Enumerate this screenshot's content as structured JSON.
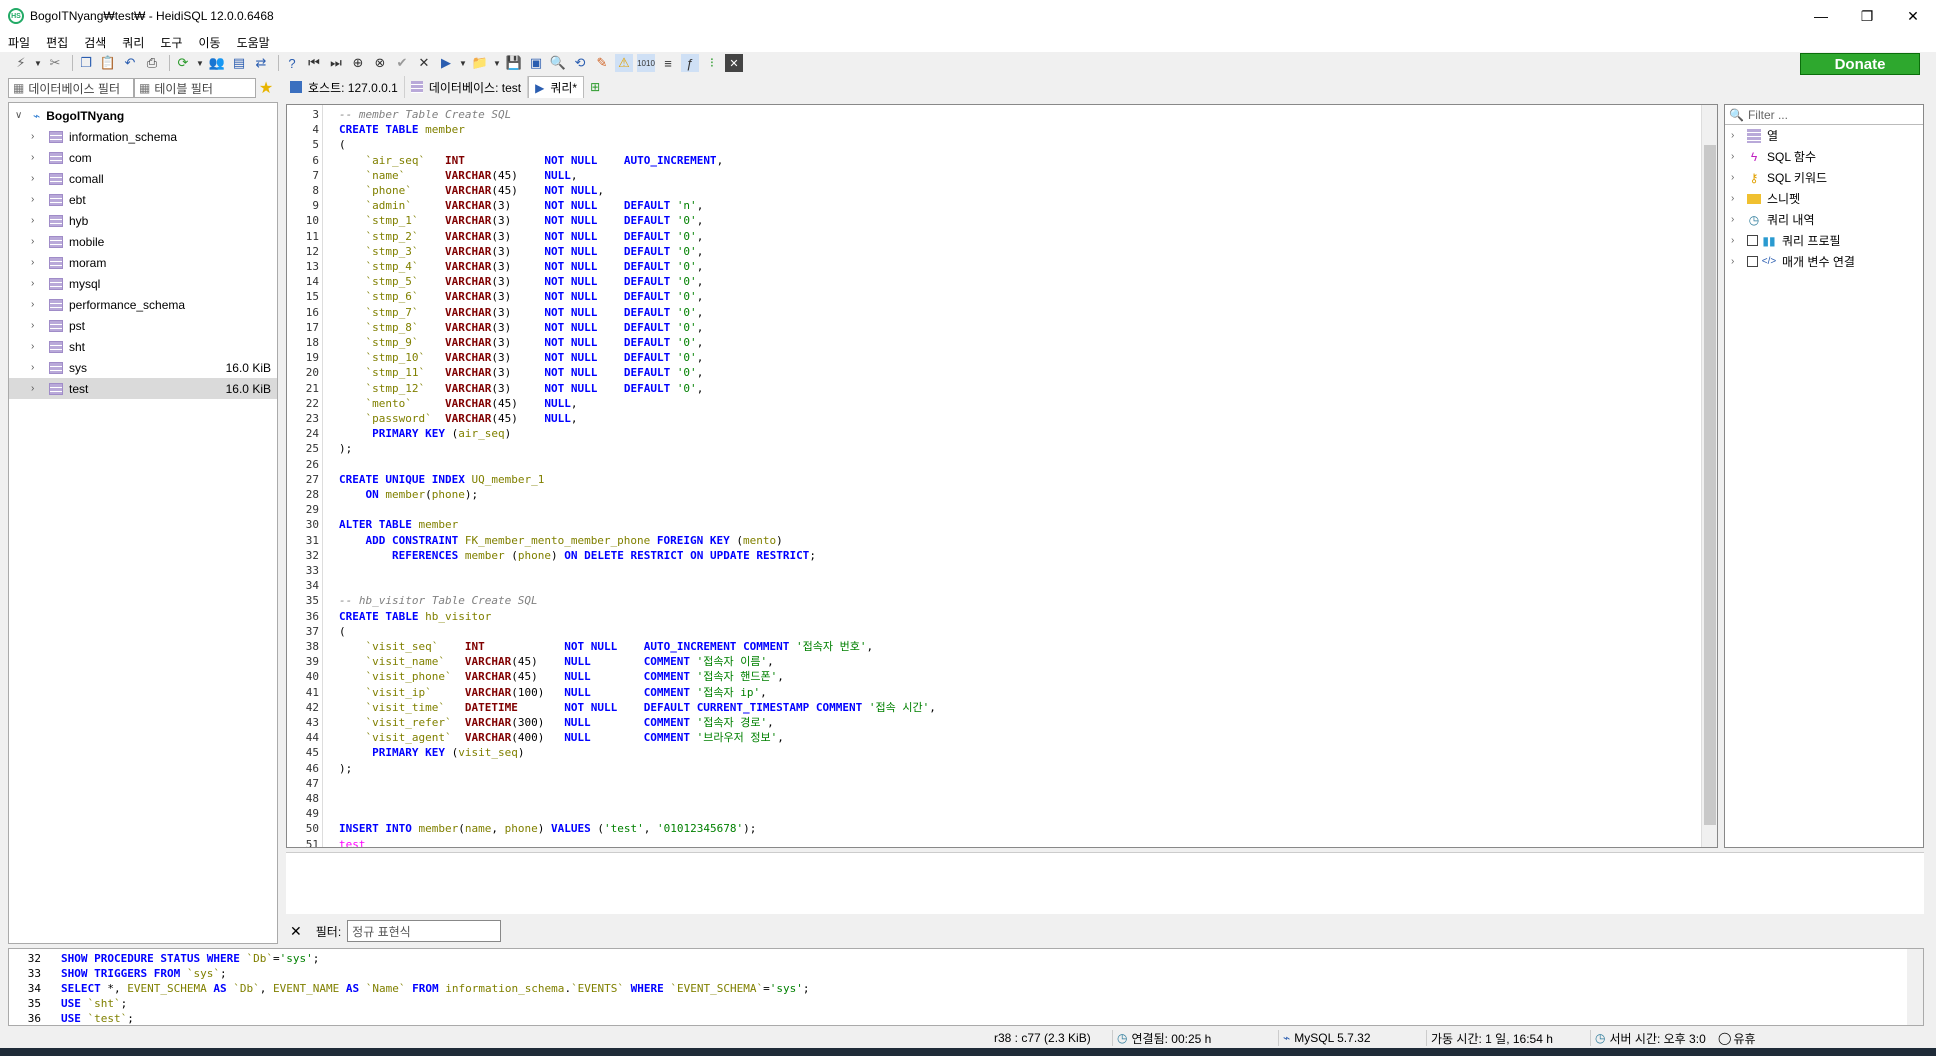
{
  "window": {
    "title": "BogoITNyang₩test₩ - HeidiSQL 12.0.0.6468",
    "minimize": "—",
    "restore": "❐",
    "close": "✕"
  },
  "menu": [
    "파일",
    "편집",
    "검색",
    "쿼리",
    "도구",
    "이동",
    "도움말"
  ],
  "donate_label": "Donate",
  "filters": {
    "database_filter_placeholder": "데이터베이스 필터",
    "table_filter_placeholder": "테이블 필터"
  },
  "tabs": [
    {
      "label": "호스트: 127.0.0.1"
    },
    {
      "label": "데이터베이스: test"
    },
    {
      "label": "쿼리*"
    }
  ],
  "tree": {
    "root": "BogoITNyang",
    "databases": [
      {
        "name": "information_schema",
        "size": ""
      },
      {
        "name": "com",
        "size": ""
      },
      {
        "name": "comall",
        "size": ""
      },
      {
        "name": "ebt",
        "size": ""
      },
      {
        "name": "hyb",
        "size": ""
      },
      {
        "name": "mobile",
        "size": ""
      },
      {
        "name": "moram",
        "size": ""
      },
      {
        "name": "mysql",
        "size": ""
      },
      {
        "name": "performance_schema",
        "size": ""
      },
      {
        "name": "pst",
        "size": ""
      },
      {
        "name": "sht",
        "size": ""
      },
      {
        "name": "sys",
        "size": "16.0 KiB"
      },
      {
        "name": "test",
        "size": "16.0 KiB"
      }
    ]
  },
  "editor_lines": [
    {
      "n": "3",
      "t": "-- member Table Create SQL"
    },
    {
      "n": "4",
      "t": "CREATE TABLE member"
    },
    {
      "n": "5",
      "t": "("
    },
    {
      "n": "6",
      "t": "    `air_seq`   INT            NOT NULL    AUTO_INCREMENT,"
    },
    {
      "n": "7",
      "t": "    `name`      VARCHAR(45)    NULL,"
    },
    {
      "n": "8",
      "t": "    `phone`     VARCHAR(45)    NOT NULL,"
    },
    {
      "n": "9",
      "t": "    `admin`     VARCHAR(3)     NOT NULL    DEFAULT 'n',"
    },
    {
      "n": "10",
      "t": "    `stmp_1`    VARCHAR(3)     NOT NULL    DEFAULT '0',"
    },
    {
      "n": "11",
      "t": "    `stmp_2`    VARCHAR(3)     NOT NULL    DEFAULT '0',"
    },
    {
      "n": "12",
      "t": "    `stmp_3`    VARCHAR(3)     NOT NULL    DEFAULT '0',"
    },
    {
      "n": "13",
      "t": "    `stmp_4`    VARCHAR(3)     NOT NULL    DEFAULT '0',"
    },
    {
      "n": "14",
      "t": "    `stmp_5`    VARCHAR(3)     NOT NULL    DEFAULT '0',"
    },
    {
      "n": "15",
      "t": "    `stmp_6`    VARCHAR(3)     NOT NULL    DEFAULT '0',"
    },
    {
      "n": "16",
      "t": "    `stmp_7`    VARCHAR(3)     NOT NULL    DEFAULT '0',"
    },
    {
      "n": "17",
      "t": "    `stmp_8`    VARCHAR(3)     NOT NULL    DEFAULT '0',"
    },
    {
      "n": "18",
      "t": "    `stmp_9`    VARCHAR(3)     NOT NULL    DEFAULT '0',"
    },
    {
      "n": "19",
      "t": "    `stmp_10`   VARCHAR(3)     NOT NULL    DEFAULT '0',"
    },
    {
      "n": "20",
      "t": "    `stmp_11`   VARCHAR(3)     NOT NULL    DEFAULT '0',"
    },
    {
      "n": "21",
      "t": "    `stmp_12`   VARCHAR(3)     NOT NULL    DEFAULT '0',"
    },
    {
      "n": "22",
      "t": "    `mento`     VARCHAR(45)    NULL,"
    },
    {
      "n": "23",
      "t": "    `password`  VARCHAR(45)    NULL,"
    },
    {
      "n": "24",
      "t": "     PRIMARY KEY (air_seq)"
    },
    {
      "n": "25",
      "t": ");"
    },
    {
      "n": "26",
      "t": ""
    },
    {
      "n": "27",
      "t": "CREATE UNIQUE INDEX UQ_member_1"
    },
    {
      "n": "28",
      "t": "    ON member(phone);"
    },
    {
      "n": "29",
      "t": ""
    },
    {
      "n": "30",
      "t": "ALTER TABLE member"
    },
    {
      "n": "31",
      "t": "    ADD CONSTRAINT FK_member_mento_member_phone FOREIGN KEY (mento)"
    },
    {
      "n": "32",
      "t": "        REFERENCES member (phone) ON DELETE RESTRICT ON UPDATE RESTRICT;"
    },
    {
      "n": "33",
      "t": ""
    },
    {
      "n": "34",
      "t": ""
    },
    {
      "n": "35",
      "t": "-- hb_visitor Table Create SQL"
    },
    {
      "n": "36",
      "t": "CREATE TABLE hb_visitor"
    },
    {
      "n": "37",
      "t": "("
    },
    {
      "n": "38",
      "t": "    `visit_seq`    INT            NOT NULL    AUTO_INCREMENT COMMENT '접속자 번호',"
    },
    {
      "n": "39",
      "t": "    `visit_name`   VARCHAR(45)    NULL        COMMENT '접속자 이름',"
    },
    {
      "n": "40",
      "t": "    `visit_phone`  VARCHAR(45)    NULL        COMMENT '접속자 핸드폰',"
    },
    {
      "n": "41",
      "t": "    `visit_ip`     VARCHAR(100)   NULL        COMMENT '접속자 ip',"
    },
    {
      "n": "42",
      "t": "    `visit_time`   DATETIME       NOT NULL    DEFAULT CURRENT_TIMESTAMP COMMENT '접속 시간',"
    },
    {
      "n": "43",
      "t": "    `visit_refer`  VARCHAR(300)   NULL        COMMENT '접속자 경로',"
    },
    {
      "n": "44",
      "t": "    `visit_agent`  VARCHAR(400)   NULL        COMMENT '브라우저 정보',"
    },
    {
      "n": "45",
      "t": "     PRIMARY KEY (visit_seq)"
    },
    {
      "n": "46",
      "t": ");"
    },
    {
      "n": "47",
      "t": ""
    },
    {
      "n": "48",
      "t": ""
    },
    {
      "n": "49",
      "t": ""
    },
    {
      "n": "50",
      "t": "INSERT INTO member(name, phone) VALUES ('test', '01012345678');"
    },
    {
      "n": "51",
      "t": "test"
    }
  ],
  "helper": {
    "filter_placeholder": "Filter ...",
    "items": [
      {
        "label": "열",
        "icon": "columns-icon"
      },
      {
        "label": "SQL 함수",
        "icon": "lightning-icon"
      },
      {
        "label": "SQL 키워드",
        "icon": "key-icon"
      },
      {
        "label": "스니펫",
        "icon": "folder-icon"
      },
      {
        "label": "쿼리 내역",
        "icon": "clock-icon"
      },
      {
        "label": "쿼리 프로필",
        "icon": "chart-icon"
      },
      {
        "label": "매개 변수 연결",
        "icon": "code-icon"
      }
    ]
  },
  "result_filter": {
    "close": "✕",
    "label": "필터:",
    "placeholder": "정규 표현식"
  },
  "log_lines": [
    {
      "n": "32",
      "t": "SHOW PROCEDURE STATUS WHERE `Db`='sys';"
    },
    {
      "n": "33",
      "t": "SHOW TRIGGERS FROM `sys`;"
    },
    {
      "n": "34",
      "t": "SELECT *, EVENT_SCHEMA AS `Db`, EVENT_NAME AS `Name` FROM information_schema.`EVENTS` WHERE `EVENT_SCHEMA`='sys';"
    },
    {
      "n": "35",
      "t": "USE `sht`;"
    },
    {
      "n": "36",
      "t": "USE `test`;"
    }
  ],
  "status": {
    "position": "r38 : c77 (2.3 KiB)",
    "connected": "연결됨: 00:25 h",
    "server": "MySQL 5.7.32",
    "uptime": "가동 시간: 1 일, 16:54 h",
    "server_time": "서버 시간: 오후 3:0",
    "idle": "유휴"
  }
}
